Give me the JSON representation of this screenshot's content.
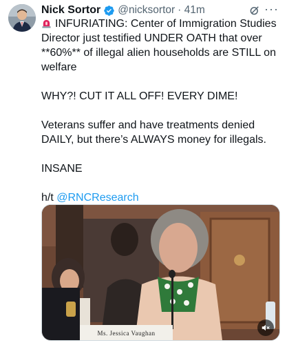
{
  "author": {
    "name": "Nick Sortor",
    "handle": "@nicksortor",
    "time": "· 41m",
    "verified": true
  },
  "tweet": {
    "line1": "INFURIATING: Center of Immigration Studies Director just testified UNDER OATH that over **60%** of illegal alien households are STILL on welfare",
    "line2": "WHY?! CUT IT ALL OFF! EVERY DIME!",
    "line3": "Veterans suffer and have treatments denied DAILY, but there’s ALWAYS money for illegals.",
    "line4": "INSANE",
    "ht_prefix": "h/t ",
    "ht_mention": "@RNCResearch"
  },
  "media": {
    "nameplate": "Ms. Jessica Vaughan"
  },
  "icons": {
    "verified": "verified-badge-icon",
    "grok": "grok-icon",
    "more": "more-icon",
    "siren": "siren-icon",
    "mute": "mute-icon"
  },
  "colors": {
    "link": "#1d9bf0",
    "secondary_text": "#536471",
    "text": "#0f1419"
  }
}
